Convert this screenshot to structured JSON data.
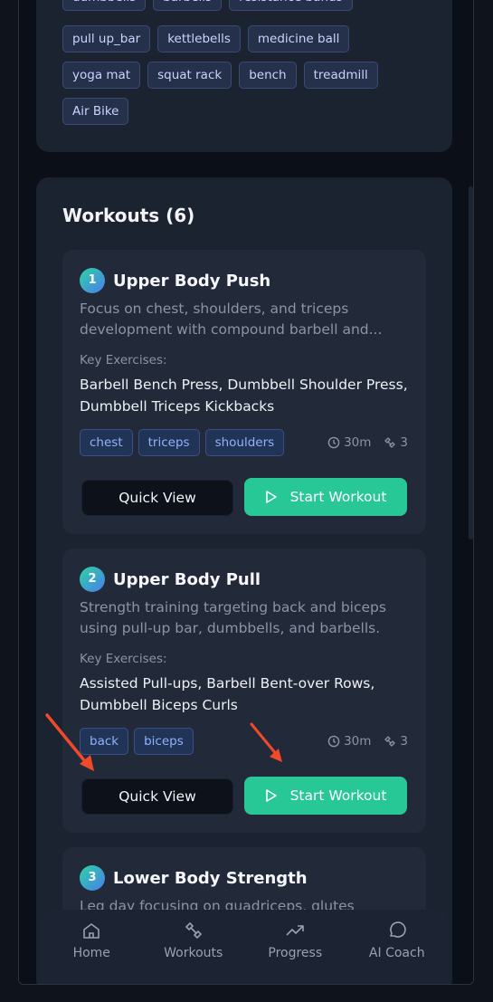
{
  "equipment": {
    "row1": [
      "dumbbells",
      "barbells",
      "resistance bands"
    ],
    "row2": [
      "pull up_bar",
      "kettlebells",
      "medicine ball"
    ],
    "row3": [
      "yoga mat",
      "squat rack",
      "bench",
      "treadmill"
    ],
    "row4": [
      "Air Bike"
    ]
  },
  "workouts": {
    "title": "Workouts (6)",
    "items": [
      {
        "number": "1",
        "title": "Upper Body Push",
        "description": "Focus on chest, shoulders, and triceps development with compound barbell and...",
        "key_label": "Key Exercises:",
        "key_exercises": "Barbell Bench Press, Dumbbell Shoulder Press, Dumbbell Triceps Kickbacks",
        "tags": [
          "chest",
          "triceps",
          "shoulders"
        ],
        "duration": "30m",
        "exercise_count": "3",
        "quick_view": "Quick View",
        "start": "Start Workout"
      },
      {
        "number": "2",
        "title": "Upper Body Pull",
        "description": "Strength training targeting back and biceps using pull-up bar, dumbbells, and barbells.",
        "key_label": "Key Exercises:",
        "key_exercises": "Assisted Pull-ups, Barbell Bent-over Rows, Dumbbell Biceps Curls",
        "tags": [
          "back",
          "biceps"
        ],
        "duration": "30m",
        "exercise_count": "3",
        "quick_view": "Quick View",
        "start": "Start Workout"
      },
      {
        "number": "3",
        "title": "Lower Body Strength",
        "description": "Leg day focusing on quadriceps, glutes"
      }
    ]
  },
  "nav": {
    "home": "Home",
    "workouts": "Workouts",
    "progress": "Progress",
    "coach": "AI Coach"
  },
  "colors": {
    "accent": "#27c796",
    "annotation": "#f04a2a"
  }
}
